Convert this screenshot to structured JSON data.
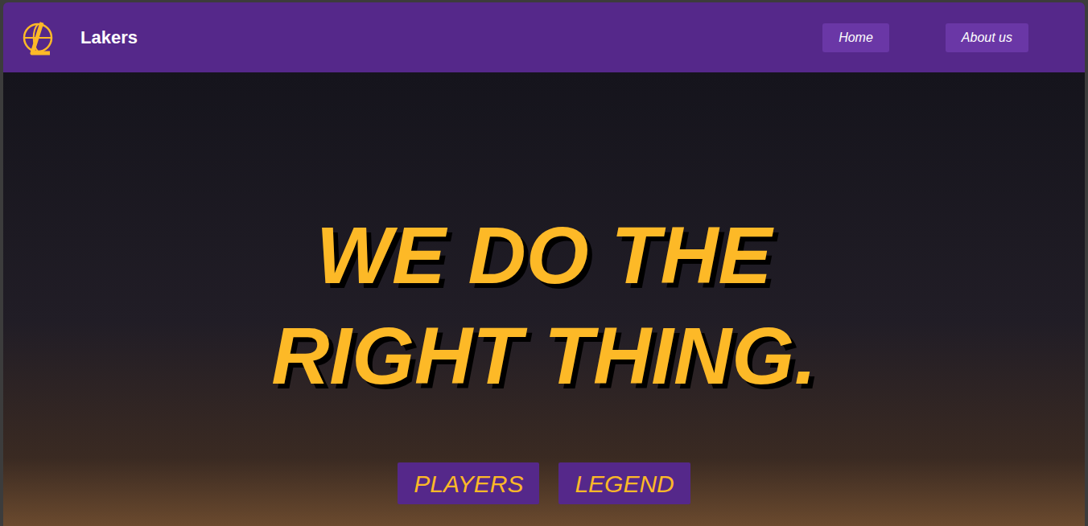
{
  "navbar": {
    "brand": "Lakers",
    "items": [
      "Home",
      "About us"
    ]
  },
  "hero": {
    "headline": "WE DO THE RIGHT THING.",
    "buttons": [
      "PLAYERS",
      "LEGEND"
    ]
  }
}
